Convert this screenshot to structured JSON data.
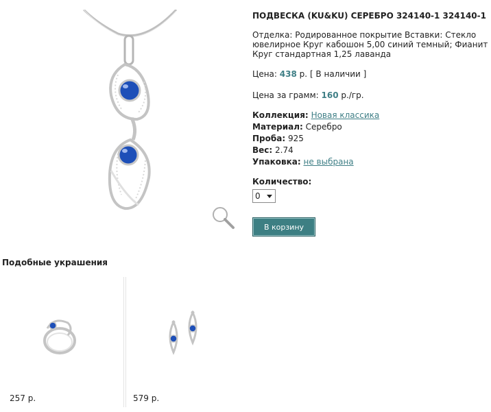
{
  "product": {
    "title": "ПОДВЕСКА (KU&KU) СЕРЕБРО 324140-1 324140-1",
    "description": "Отделка: Родированное покрытие Вставки: Стекло ювелирное Круг кабошон 5,00 синий темный; Фианит Круг стандартная 1,25 лаванда",
    "price_label": "Цена:",
    "price_value": "438",
    "price_unit": "р.",
    "availability": "[ В наличии ]",
    "price_per_gram_label": "Цена за грамм:",
    "price_per_gram_value": "160",
    "price_per_gram_unit": "р./гр.",
    "collection_label": "Коллекция:",
    "collection_value": "Новая классика",
    "material_label": "Материал:",
    "material_value": "Серебро",
    "proba_label": "Проба:",
    "proba_value": "925",
    "weight_label": "Вес:",
    "weight_value": "2.74",
    "packaging_label": "Упаковка:",
    "packaging_value": "не выбрана",
    "quantity_label": "Количество:",
    "quantity_value": "0",
    "cart_button": "В корзину"
  },
  "similar": {
    "title": "Подобные украшения",
    "items": [
      {
        "price": "257 р."
      },
      {
        "price": "579 р."
      }
    ]
  },
  "colors": {
    "accent": "#3f7f86",
    "button": "#3d7f83",
    "stone": "#1d4fb8"
  },
  "icons": {
    "zoom": "magnifier-icon",
    "dropdown": "chevron-down-icon"
  }
}
